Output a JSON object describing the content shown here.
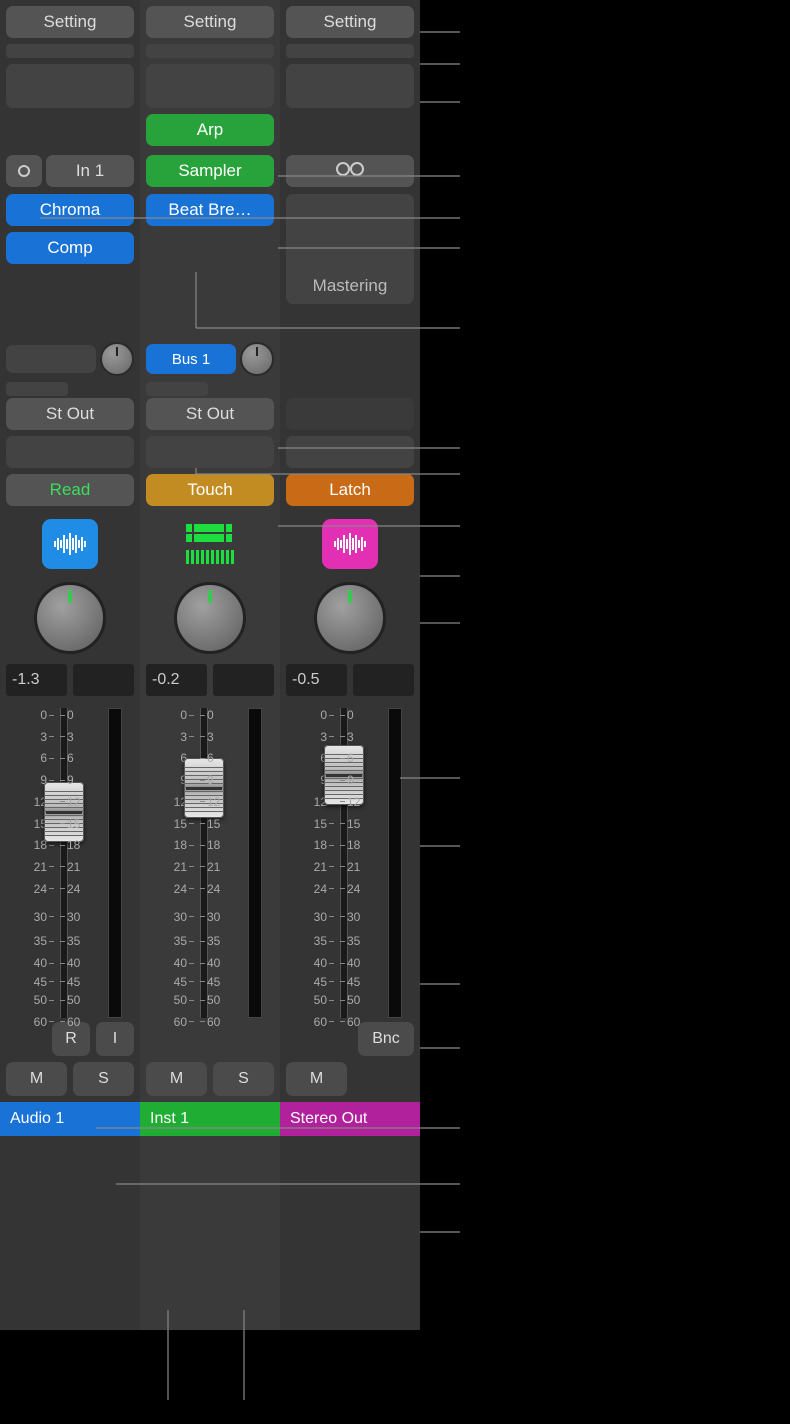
{
  "strips": [
    {
      "setting": "Setting",
      "input_label": "In 1",
      "plugins": [
        "Chroma",
        "Comp"
      ],
      "output": "St Out",
      "automation": {
        "label": "Read",
        "style": "read"
      },
      "icon": "waveform-blue",
      "level_db": "-1.3",
      "fader_pos_pct": 24,
      "rec_button": "R",
      "input_button": "I",
      "mute": "M",
      "solo": "S",
      "name": "Audio 1",
      "name_color": "blue"
    },
    {
      "setting": "Setting",
      "midi_fx": "Arp",
      "instrument": "Sampler",
      "plugins": [
        "Beat Bre…"
      ],
      "send": {
        "label": "Bus 1"
      },
      "output": "St Out",
      "automation": {
        "label": "Touch",
        "style": "gold"
      },
      "icon": "segments-green",
      "level_db": "-0.2",
      "fader_pos_pct": 16,
      "mute": "M",
      "solo": "S",
      "name": "Inst 1",
      "name_color": "green"
    },
    {
      "setting": "Setting",
      "stereo_link": true,
      "mastering": "Mastering",
      "automation": {
        "label": "Latch",
        "style": "orange"
      },
      "icon": "waveform-magenta",
      "level_db": "-0.5",
      "fader_pos_pct": 12,
      "bounce": "Bnc",
      "mute": "M",
      "name": "Stereo Out",
      "name_color": "purple"
    }
  ],
  "fader_scale": [
    "0",
    "3",
    "6",
    "9",
    "12",
    "15",
    "18",
    "21",
    "24",
    "30",
    "35",
    "40",
    "45",
    "50",
    "60"
  ]
}
